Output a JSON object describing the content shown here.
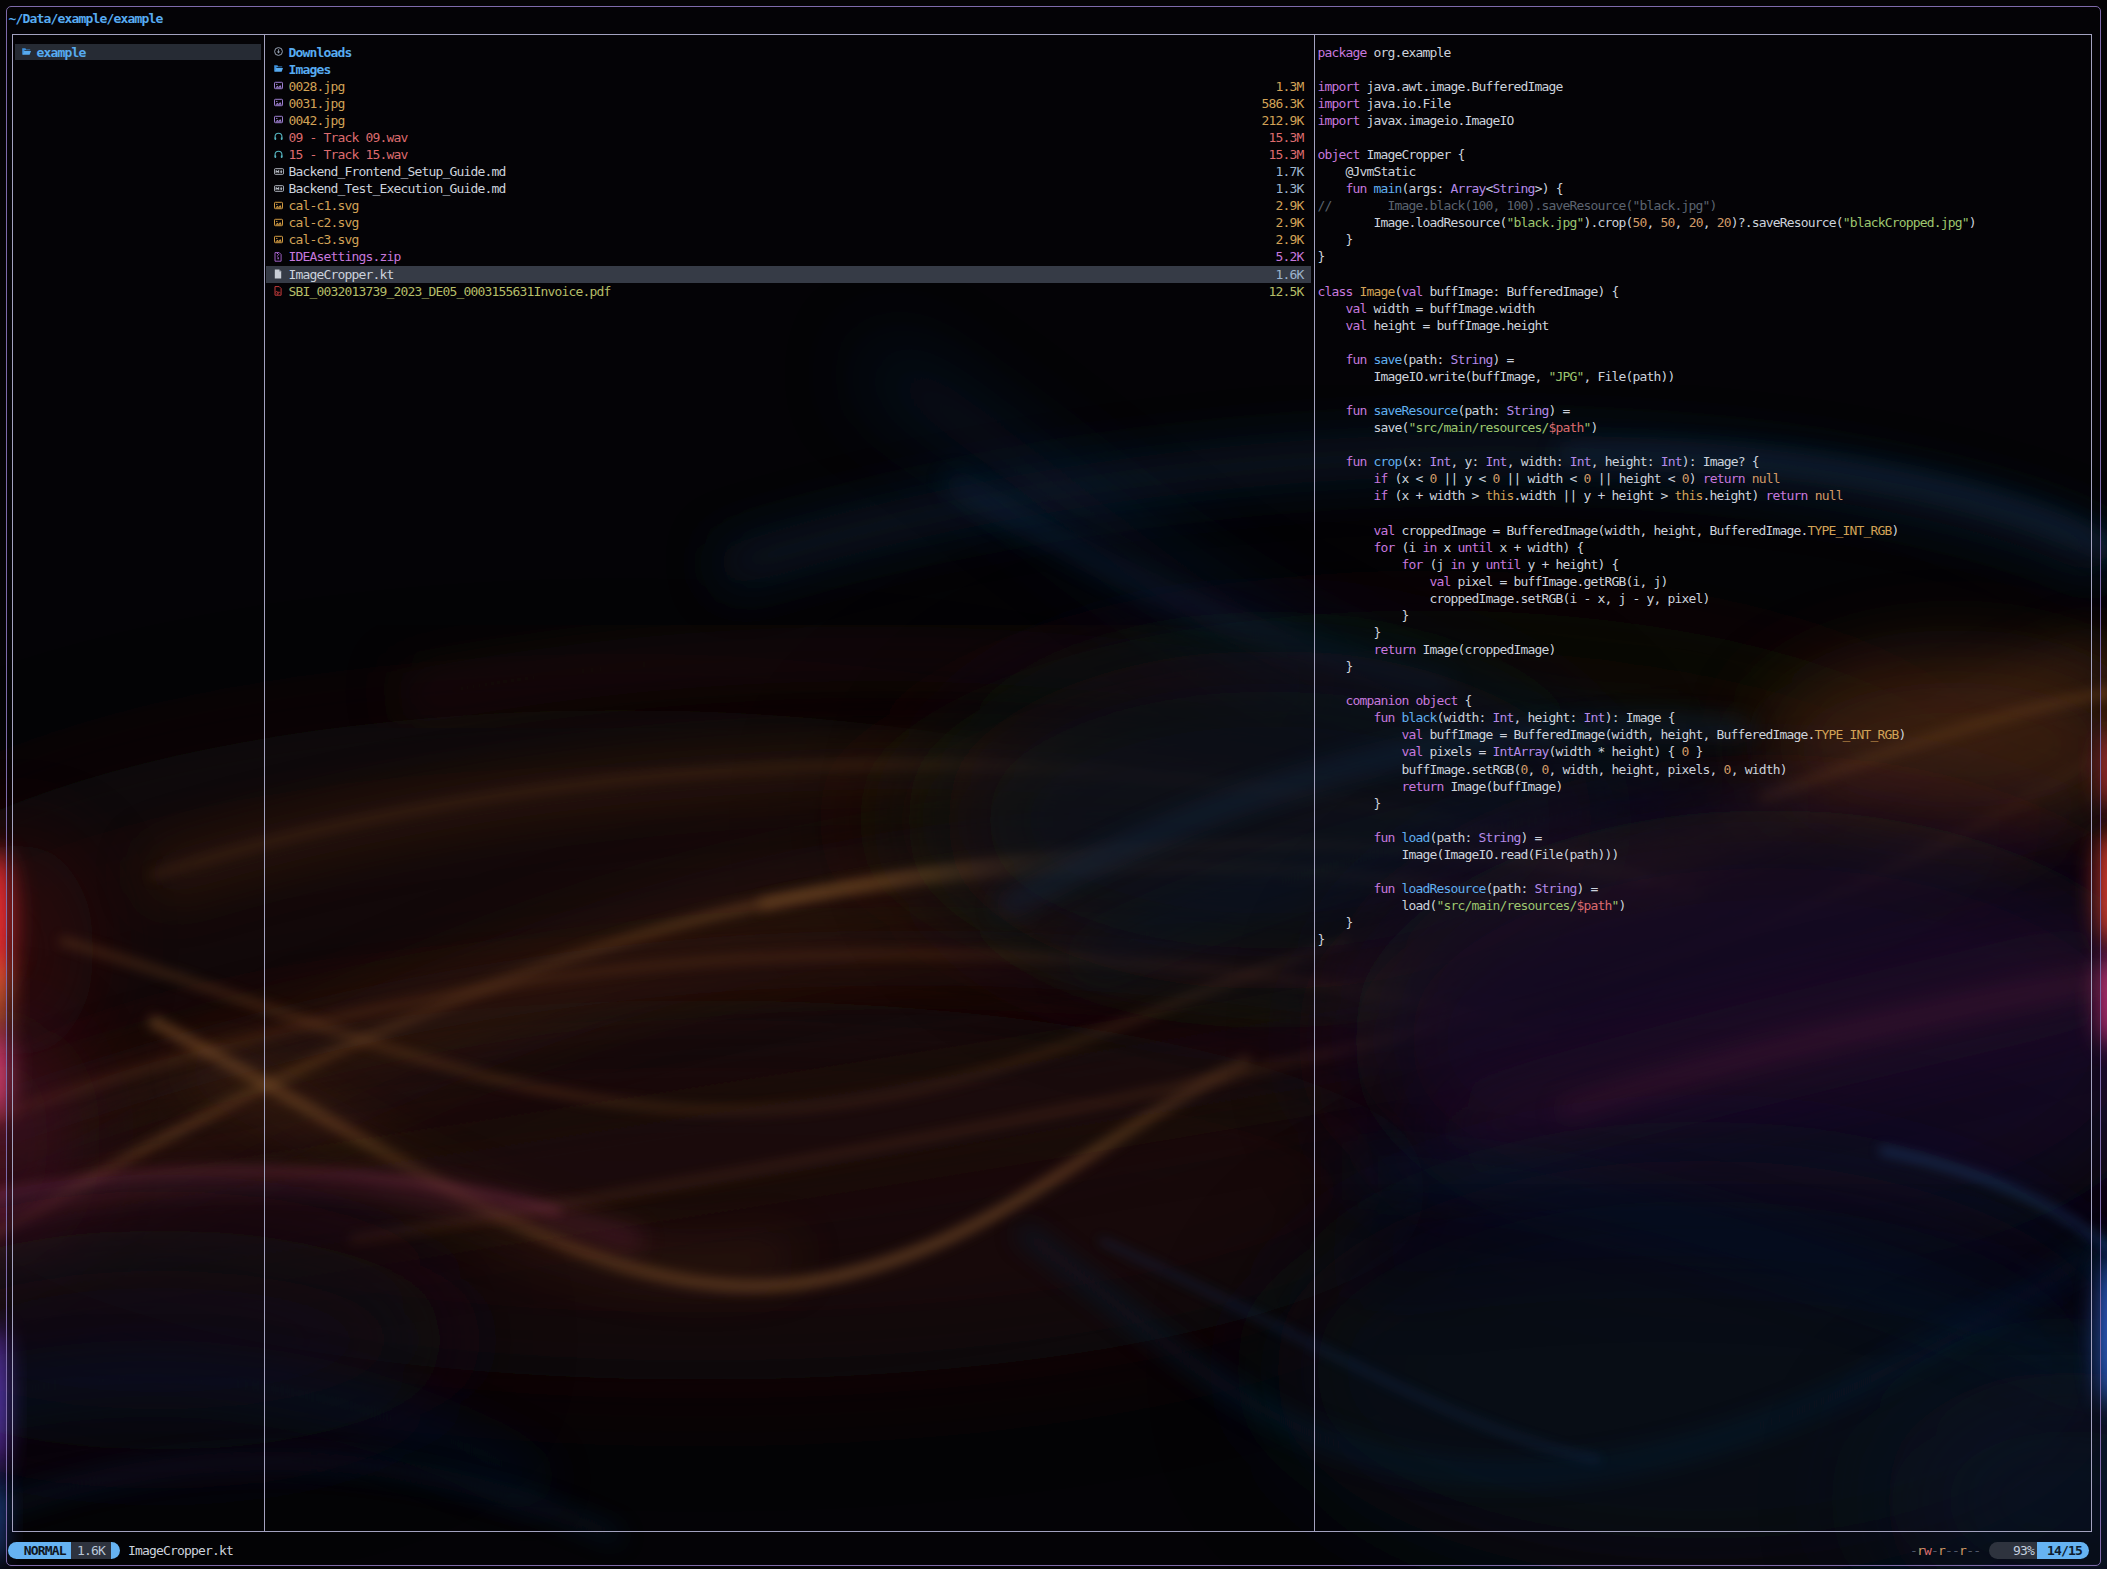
{
  "header": {
    "path": "~/Data/example/example"
  },
  "parent_pane": {
    "items": [
      {
        "name": "example",
        "icon": "folder-open-icon",
        "kind": "dir",
        "hovered": true
      }
    ]
  },
  "file_pane": {
    "items": [
      {
        "name": "Downloads",
        "size": "",
        "icon": "download-circle-icon",
        "kind": "dir"
      },
      {
        "name": "Images",
        "size": "",
        "icon": "folder-open-icon",
        "kind": "dir"
      },
      {
        "name": "0028.jpg",
        "size": "1.3M",
        "icon": "image-icon-purple",
        "kind": "image"
      },
      {
        "name": "0031.jpg",
        "size": "586.3K",
        "icon": "image-icon-purple",
        "kind": "image"
      },
      {
        "name": "0042.jpg",
        "size": "212.9K",
        "icon": "image-icon-purple",
        "kind": "image"
      },
      {
        "name": "09 - Track 09.wav",
        "size": "15.3M",
        "icon": "headphones-icon",
        "kind": "audio"
      },
      {
        "name": "15 - Track 15.wav",
        "size": "15.3M",
        "icon": "headphones-icon",
        "kind": "audio"
      },
      {
        "name": "Backend_Frontend_Setup_Guide.md",
        "size": "1.7K",
        "icon": "markdown-icon",
        "kind": "doc"
      },
      {
        "name": "Backend_Test_Execution_Guide.md",
        "size": "1.3K",
        "icon": "markdown-icon",
        "kind": "doc"
      },
      {
        "name": "cal-c1.svg",
        "size": "2.9K",
        "icon": "image-icon-orange",
        "kind": "image"
      },
      {
        "name": "cal-c2.svg",
        "size": "2.9K",
        "icon": "image-icon-orange",
        "kind": "image"
      },
      {
        "name": "cal-c3.svg",
        "size": "2.9K",
        "icon": "image-icon-orange",
        "kind": "image"
      },
      {
        "name": "IDEAsettings.zip",
        "size": "5.2K",
        "icon": "zip-icon",
        "kind": "archive"
      },
      {
        "name": "ImageCropper.kt",
        "size": "1.6K",
        "icon": "file-icon",
        "kind": "doc",
        "hovered": true
      },
      {
        "name": "SBI_0032013739_2023_DE05_0003155631Invoice.pdf",
        "size": "12.5K",
        "icon": "pdf-icon",
        "kind": "pdf"
      }
    ]
  },
  "preview_pane": {
    "code_lines": [
      [
        [
          "k",
          "package"
        ],
        [
          "w",
          " org.example"
        ]
      ],
      [],
      [
        [
          "k",
          "import"
        ],
        [
          "w",
          " java.awt.image.BufferedImage"
        ]
      ],
      [
        [
          "k",
          "import"
        ],
        [
          "w",
          " java.io.File"
        ]
      ],
      [
        [
          "k",
          "import"
        ],
        [
          "w",
          " javax.imageio.ImageIO"
        ]
      ],
      [],
      [
        [
          "k",
          "object"
        ],
        [
          "w",
          " ImageCropper {"
        ]
      ],
      [
        [
          "w",
          "    @JvmStatic"
        ]
      ],
      [
        [
          "w",
          "    "
        ],
        [
          "k",
          "fun"
        ],
        [
          "w",
          " "
        ],
        [
          "f",
          "main"
        ],
        [
          "w",
          "(args: "
        ],
        [
          "t2",
          "Array"
        ],
        [
          "w",
          "<"
        ],
        [
          "t2",
          "String"
        ],
        [
          "w",
          ">) {"
        ]
      ],
      [
        [
          "c",
          "//        Image.black(100, 100).saveResource(\"black.jpg\")"
        ]
      ],
      [
        [
          "w",
          "        Image.loadResource("
        ],
        [
          "s",
          "\"black.jpg\""
        ],
        [
          "w",
          ").crop("
        ],
        [
          "n",
          "50"
        ],
        [
          "w",
          ", "
        ],
        [
          "n",
          "50"
        ],
        [
          "w",
          ", "
        ],
        [
          "n",
          "20"
        ],
        [
          "w",
          ", "
        ],
        [
          "n",
          "20"
        ],
        [
          "w",
          ")?.saveResource("
        ],
        [
          "s",
          "\"blackCropped.jpg\""
        ],
        [
          "w",
          ")"
        ]
      ],
      [
        [
          "w",
          "    }"
        ]
      ],
      [
        [
          "w",
          "}"
        ]
      ],
      [],
      [
        [
          "k",
          "class"
        ],
        [
          "w",
          " "
        ],
        [
          "y",
          "Image"
        ],
        [
          "w",
          "("
        ],
        [
          "k",
          "val"
        ],
        [
          "w",
          " buffImage: BufferedImage) {"
        ]
      ],
      [
        [
          "w",
          "    "
        ],
        [
          "k",
          "val"
        ],
        [
          "w",
          " width = buffImage.width"
        ]
      ],
      [
        [
          "w",
          "    "
        ],
        [
          "k",
          "val"
        ],
        [
          "w",
          " height = buffImage.height"
        ]
      ],
      [],
      [
        [
          "w",
          "    "
        ],
        [
          "k",
          "fun"
        ],
        [
          "w",
          " "
        ],
        [
          "f",
          "save"
        ],
        [
          "w",
          "(path: "
        ],
        [
          "t2",
          "String"
        ],
        [
          "w",
          ") ="
        ]
      ],
      [
        [
          "w",
          "        ImageIO.write(buffImage, "
        ],
        [
          "s",
          "\"JPG\""
        ],
        [
          "w",
          ", File(path))"
        ]
      ],
      [],
      [
        [
          "w",
          "    "
        ],
        [
          "k",
          "fun"
        ],
        [
          "w",
          " "
        ],
        [
          "f",
          "saveResource"
        ],
        [
          "w",
          "(path: "
        ],
        [
          "t2",
          "String"
        ],
        [
          "w",
          ") ="
        ]
      ],
      [
        [
          "w",
          "        save("
        ],
        [
          "s",
          "\"src/main/resources/"
        ],
        [
          "r",
          "$path"
        ],
        [
          "s",
          "\""
        ],
        [
          "w",
          ")"
        ]
      ],
      [],
      [
        [
          "w",
          "    "
        ],
        [
          "k",
          "fun"
        ],
        [
          "w",
          " "
        ],
        [
          "f",
          "crop"
        ],
        [
          "w",
          "(x: "
        ],
        [
          "t2",
          "Int"
        ],
        [
          "w",
          ", y: "
        ],
        [
          "t2",
          "Int"
        ],
        [
          "w",
          ", width: "
        ],
        [
          "t2",
          "Int"
        ],
        [
          "w",
          ", height: "
        ],
        [
          "t2",
          "Int"
        ],
        [
          "w",
          "): Image? {"
        ]
      ],
      [
        [
          "w",
          "        "
        ],
        [
          "k",
          "if"
        ],
        [
          "w",
          " (x < "
        ],
        [
          "n",
          "0"
        ],
        [
          "w",
          " || y < "
        ],
        [
          "n",
          "0"
        ],
        [
          "w",
          " || width < "
        ],
        [
          "n",
          "0"
        ],
        [
          "w",
          " || height < "
        ],
        [
          "n",
          "0"
        ],
        [
          "w",
          ") "
        ],
        [
          "k",
          "return"
        ],
        [
          "w",
          " "
        ],
        [
          "n",
          "null"
        ]
      ],
      [
        [
          "w",
          "        "
        ],
        [
          "k",
          "if"
        ],
        [
          "w",
          " (x + width > "
        ],
        [
          "y",
          "this"
        ],
        [
          "w",
          ".width || y + height > "
        ],
        [
          "y",
          "this"
        ],
        [
          "w",
          ".height) "
        ],
        [
          "k",
          "return"
        ],
        [
          "w",
          " "
        ],
        [
          "n",
          "null"
        ]
      ],
      [],
      [
        [
          "w",
          "        "
        ],
        [
          "k",
          "val"
        ],
        [
          "w",
          " croppedImage = BufferedImage(width, height, BufferedImage."
        ],
        [
          "y",
          "TYPE_INT_RGB"
        ],
        [
          "w",
          ")"
        ]
      ],
      [
        [
          "w",
          "        "
        ],
        [
          "k",
          "for"
        ],
        [
          "w",
          " (i "
        ],
        [
          "k",
          "in"
        ],
        [
          "w",
          " x "
        ],
        [
          "k",
          "until"
        ],
        [
          "w",
          " x + width) {"
        ]
      ],
      [
        [
          "w",
          "            "
        ],
        [
          "k",
          "for"
        ],
        [
          "w",
          " (j "
        ],
        [
          "k",
          "in"
        ],
        [
          "w",
          " y "
        ],
        [
          "k",
          "until"
        ],
        [
          "w",
          " y + height) {"
        ]
      ],
      [
        [
          "w",
          "                "
        ],
        [
          "k",
          "val"
        ],
        [
          "w",
          " pixel = buffImage.getRGB(i, j)"
        ]
      ],
      [
        [
          "w",
          "                croppedImage.setRGB(i - x, j - y, pixel)"
        ]
      ],
      [
        [
          "w",
          "            }"
        ]
      ],
      [
        [
          "w",
          "        }"
        ]
      ],
      [
        [
          "w",
          "        "
        ],
        [
          "k",
          "return"
        ],
        [
          "w",
          " Image(croppedImage)"
        ]
      ],
      [
        [
          "w",
          "    }"
        ]
      ],
      [],
      [
        [
          "w",
          "    "
        ],
        [
          "k",
          "companion"
        ],
        [
          "w",
          " "
        ],
        [
          "k",
          "object"
        ],
        [
          "w",
          " {"
        ]
      ],
      [
        [
          "w",
          "        "
        ],
        [
          "k",
          "fun"
        ],
        [
          "w",
          " "
        ],
        [
          "f",
          "black"
        ],
        [
          "w",
          "(width: "
        ],
        [
          "t2",
          "Int"
        ],
        [
          "w",
          ", height: "
        ],
        [
          "t2",
          "Int"
        ],
        [
          "w",
          "): Image {"
        ]
      ],
      [
        [
          "w",
          "            "
        ],
        [
          "k",
          "val"
        ],
        [
          "w",
          " buffImage = BufferedImage(width, height, BufferedImage."
        ],
        [
          "y",
          "TYPE_INT_RGB"
        ],
        [
          "w",
          ")"
        ]
      ],
      [
        [
          "w",
          "            "
        ],
        [
          "k",
          "val"
        ],
        [
          "w",
          " pixels = "
        ],
        [
          "t2",
          "IntArray"
        ],
        [
          "w",
          "(width * height) { "
        ],
        [
          "n",
          "0"
        ],
        [
          "w",
          " }"
        ]
      ],
      [
        [
          "w",
          "            buffImage.setRGB("
        ],
        [
          "n",
          "0"
        ],
        [
          "w",
          ", "
        ],
        [
          "n",
          "0"
        ],
        [
          "w",
          ", width, height, pixels, "
        ],
        [
          "n",
          "0"
        ],
        [
          "w",
          ", width)"
        ]
      ],
      [
        [
          "w",
          "            "
        ],
        [
          "k",
          "return"
        ],
        [
          "w",
          " Image(buffImage)"
        ]
      ],
      [
        [
          "w",
          "        }"
        ]
      ],
      [],
      [
        [
          "w",
          "        "
        ],
        [
          "k",
          "fun"
        ],
        [
          "w",
          " "
        ],
        [
          "f",
          "load"
        ],
        [
          "w",
          "(path: "
        ],
        [
          "t2",
          "String"
        ],
        [
          "w",
          ") ="
        ]
      ],
      [
        [
          "w",
          "            Image(ImageIO.read(File(path)))"
        ]
      ],
      [],
      [
        [
          "w",
          "        "
        ],
        [
          "k",
          "fun"
        ],
        [
          "w",
          " "
        ],
        [
          "f",
          "loadResource"
        ],
        [
          "w",
          "(path: "
        ],
        [
          "t2",
          "String"
        ],
        [
          "w",
          ") ="
        ]
      ],
      [
        [
          "w",
          "            load("
        ],
        [
          "s",
          "\"src/main/resources/"
        ],
        [
          "r",
          "$path"
        ],
        [
          "s",
          "\""
        ],
        [
          "w",
          ")"
        ]
      ],
      [
        [
          "w",
          "    }"
        ]
      ],
      [
        [
          "w",
          "}"
        ]
      ]
    ]
  },
  "status_bar": {
    "mode": "NORMAL",
    "file_size": "1.6K",
    "file_name": "ImageCropper.kt",
    "permissions": "-rw-r--r--",
    "percent": "93%",
    "position": "14/15"
  },
  "colors": {
    "accent_blue": "#61aff0",
    "window_border": "#7e6aaa",
    "pane_border": "#a3a2bf",
    "hover_parent_bg": "#262b34",
    "hover_current_bg": "#363b46",
    "mode_pill_bg": "#66b3f2",
    "mode_pill_text": "#10161f",
    "status_dark_seg_bg": "#2e333e",
    "file_kind_colors": {
      "dir": "#57abf0",
      "image": "#d2a256",
      "audio": "#dd6b6e",
      "doc": "#ccd2dc",
      "archive": "#c678dd",
      "pdf": "#b5bd68",
      "size_neutral": "#9db4cd"
    },
    "syntax": {
      "keyword": "#c678dd",
      "function": "#61afef",
      "type": "#b48ae8",
      "string": "#9ec66f",
      "number": "#d19a66",
      "constant": "#d2a256",
      "template_var": "#dc6a6e",
      "comment": "#5c6370",
      "plain": "#ccd2dc"
    }
  }
}
